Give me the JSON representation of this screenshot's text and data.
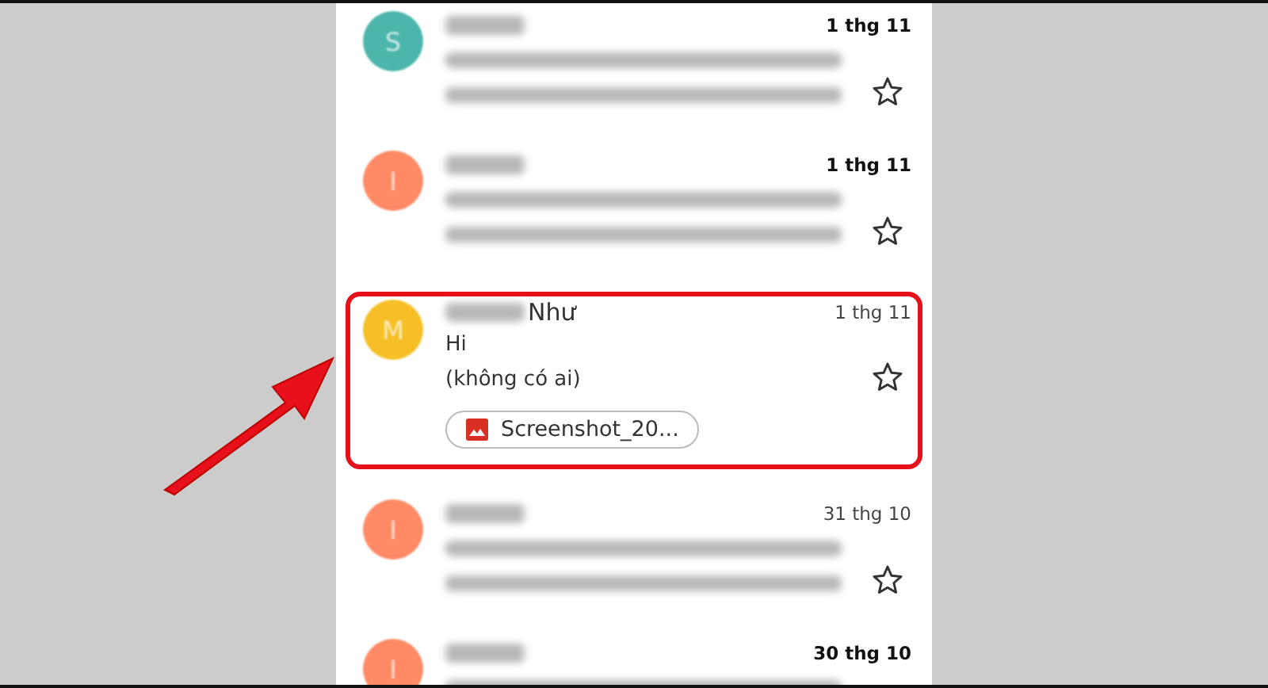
{
  "messages": [
    {
      "avatar": "S",
      "color": "#4db6ac",
      "date": "1 thg 11",
      "unread": true,
      "highlighted": false,
      "starred": false
    },
    {
      "avatar": "I",
      "color": "#ff8a65",
      "date": "1 thg 11",
      "unread": true,
      "highlighted": false,
      "starred": false
    },
    {
      "avatar": "M",
      "color": "#f6bf26",
      "sender": "Như",
      "date": "1 thg 11",
      "unread": false,
      "subject": "Hi",
      "snippet": "(không có ai)",
      "attachment": "Screenshot_20...",
      "highlighted": true,
      "starred": false
    },
    {
      "avatar": "I",
      "color": "#ff8a65",
      "date": "31 thg 10",
      "unread": false,
      "highlighted": false,
      "starred": false
    },
    {
      "avatar": "I",
      "color": "#ff8a65",
      "date": "30 thg 10",
      "unread": true,
      "highlighted": false
    }
  ]
}
